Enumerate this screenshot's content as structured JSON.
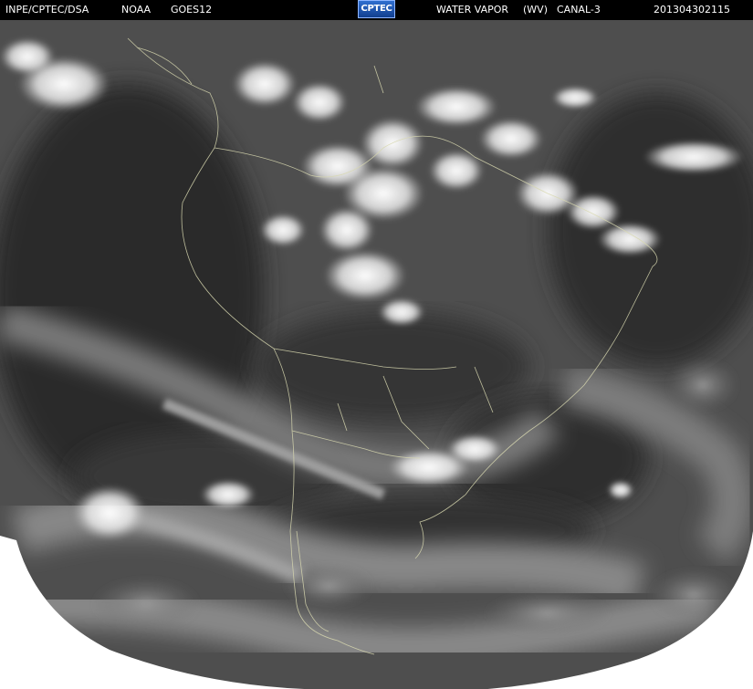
{
  "header": {
    "source": "INPE/CPTEC/DSA",
    "agency": "NOAA",
    "satellite": "GOES12",
    "logo_text": "CPTEC",
    "channel_type": "WATER VAPOR",
    "channel_abbrev": "(WV)",
    "channel": "CANAL-3",
    "timestamp": "201304302115"
  },
  "colors": {
    "header_bg": "#000000",
    "header_text": "#ffffff",
    "background": "#ffffff",
    "dark_vapor": "#2a2a2a",
    "mid_vapor": "#555555",
    "cloud": "#f2f2f2",
    "coastline": "#d8d8b0"
  },
  "icons": {
    "logo": "cptec-logo"
  }
}
